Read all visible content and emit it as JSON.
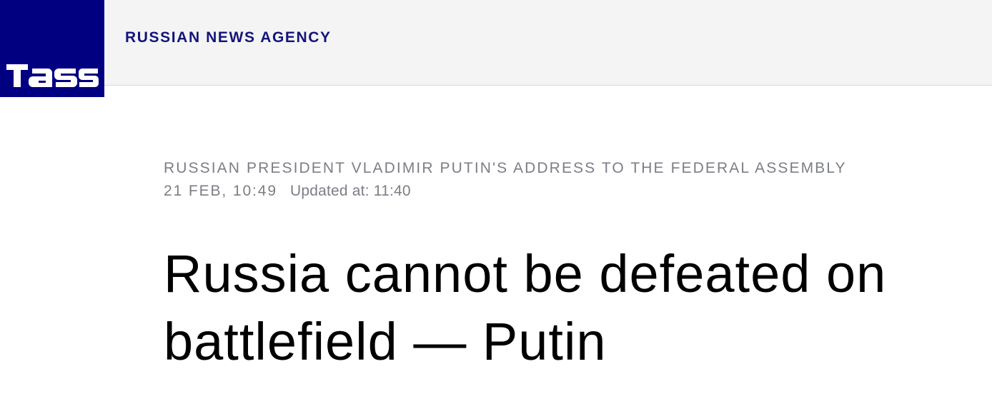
{
  "header": {
    "logo_text": "TASS",
    "agency_name": "RUSSIAN NEWS AGENCY"
  },
  "article": {
    "rubric": "RUSSIAN PRESIDENT VLADIMIR PUTIN'S ADDRESS TO THE FEDERAL ASSEMBLY",
    "date": "21 FEB, 10:49",
    "updated": "Updated at: 11:40",
    "headline": "Russia cannot be defeated on battlefield — Putin"
  },
  "colors": {
    "brand_blue": "#000080",
    "agency_text": "#14147a",
    "meta_gray": "#7c7e86",
    "header_bg": "#f4f4f5"
  }
}
